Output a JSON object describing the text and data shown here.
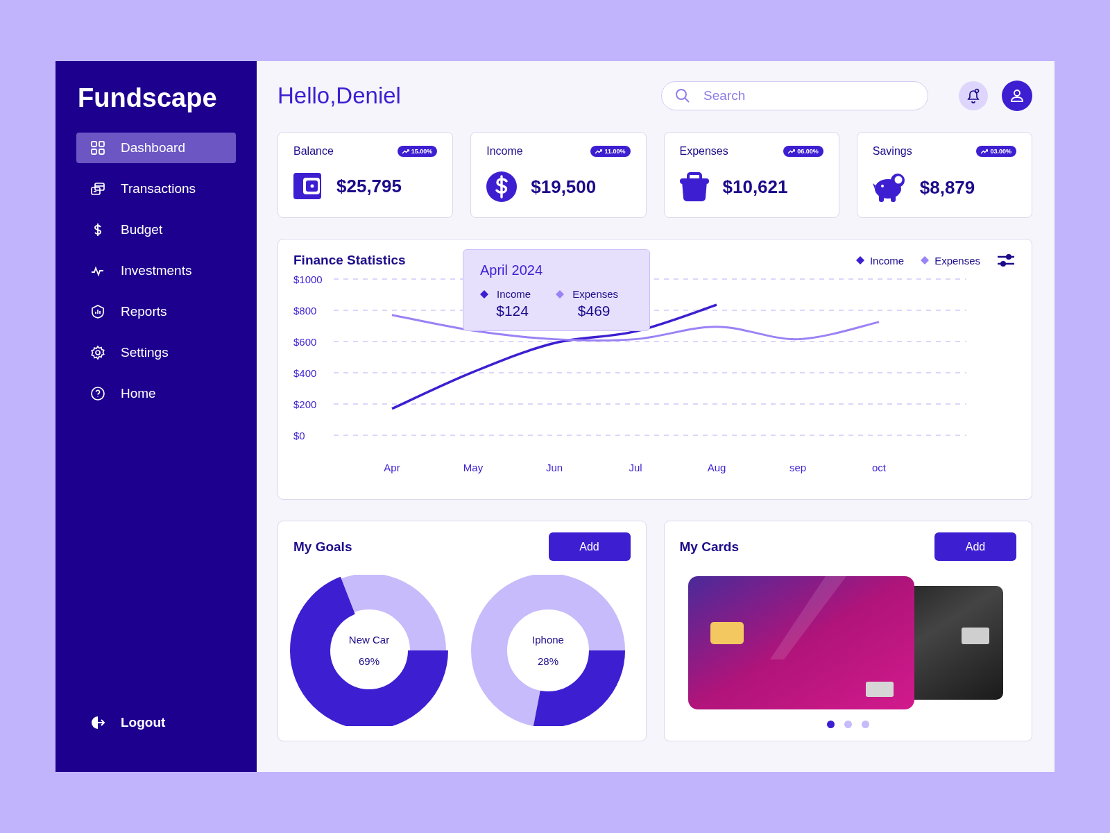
{
  "sidebar": {
    "logo": "Fundscape",
    "items": [
      {
        "label": "Dashboard",
        "selected": true
      },
      {
        "label": "Transactions",
        "selected": false
      },
      {
        "label": "Budget",
        "selected": false
      },
      {
        "label": "Investments",
        "selected": false
      },
      {
        "label": "Reports",
        "selected": false
      },
      {
        "label": "Settings",
        "selected": false
      },
      {
        "label": "Home",
        "selected": false
      }
    ],
    "logout": "Logout"
  },
  "header": {
    "greeting": "Hello,Deniel",
    "search": {
      "placeholder": "Search"
    }
  },
  "stats": [
    {
      "label": "Balance",
      "badge": "15.00%",
      "value": "$25,795"
    },
    {
      "label": "Income",
      "badge": "11.00%",
      "value": "$19,500"
    },
    {
      "label": "Expenses",
      "badge": "06.00%",
      "value": "$10,621"
    },
    {
      "label": "Savings",
      "badge": "03.00%",
      "value": "$8,879"
    }
  ],
  "finance": {
    "title": "Finance Statistics",
    "tooltip": {
      "title": "April 2024",
      "items": [
        {
          "name": "Income",
          "value": "$124"
        },
        {
          "name": "Expenses",
          "value": "$469"
        }
      ]
    },
    "chart_data": {
      "type": "line",
      "categories": [
        "Apr",
        "May",
        "Jun",
        "Jul",
        "Aug",
        "sep",
        "oct"
      ],
      "ylim": [
        0,
        1000
      ],
      "grid": true,
      "yticks": [
        {
          "value": 0,
          "label": "$0"
        },
        {
          "value": 200,
          "label": "$200"
        },
        {
          "value": 400,
          "label": "$400"
        },
        {
          "value": 600,
          "label": "$600"
        },
        {
          "value": 800,
          "label": "$800"
        },
        {
          "value": 1000,
          "label": "$1000"
        }
      ],
      "series": [
        {
          "name": "Income",
          "color": "#3d1fd1",
          "values": [
            170,
            405,
            590,
            665,
            835,
            null,
            null
          ]
        },
        {
          "name": "Expenses",
          "color": "#9b82f5",
          "values": [
            770,
            670,
            615,
            615,
            695,
            615,
            725
          ]
        }
      ]
    }
  },
  "goals": {
    "title": "My Goals",
    "button": "Add",
    "items": [
      {
        "name": "New Car",
        "percent": "69%",
        "level": 0.69
      },
      {
        "name": "Iphone",
        "percent": "28%",
        "level": 0.28
      }
    ]
  },
  "cards": {
    "title": "My Cards",
    "button": "Add",
    "dots": [
      {
        "selected": true
      },
      {
        "selected": false
      },
      {
        "selected": false
      }
    ]
  }
}
